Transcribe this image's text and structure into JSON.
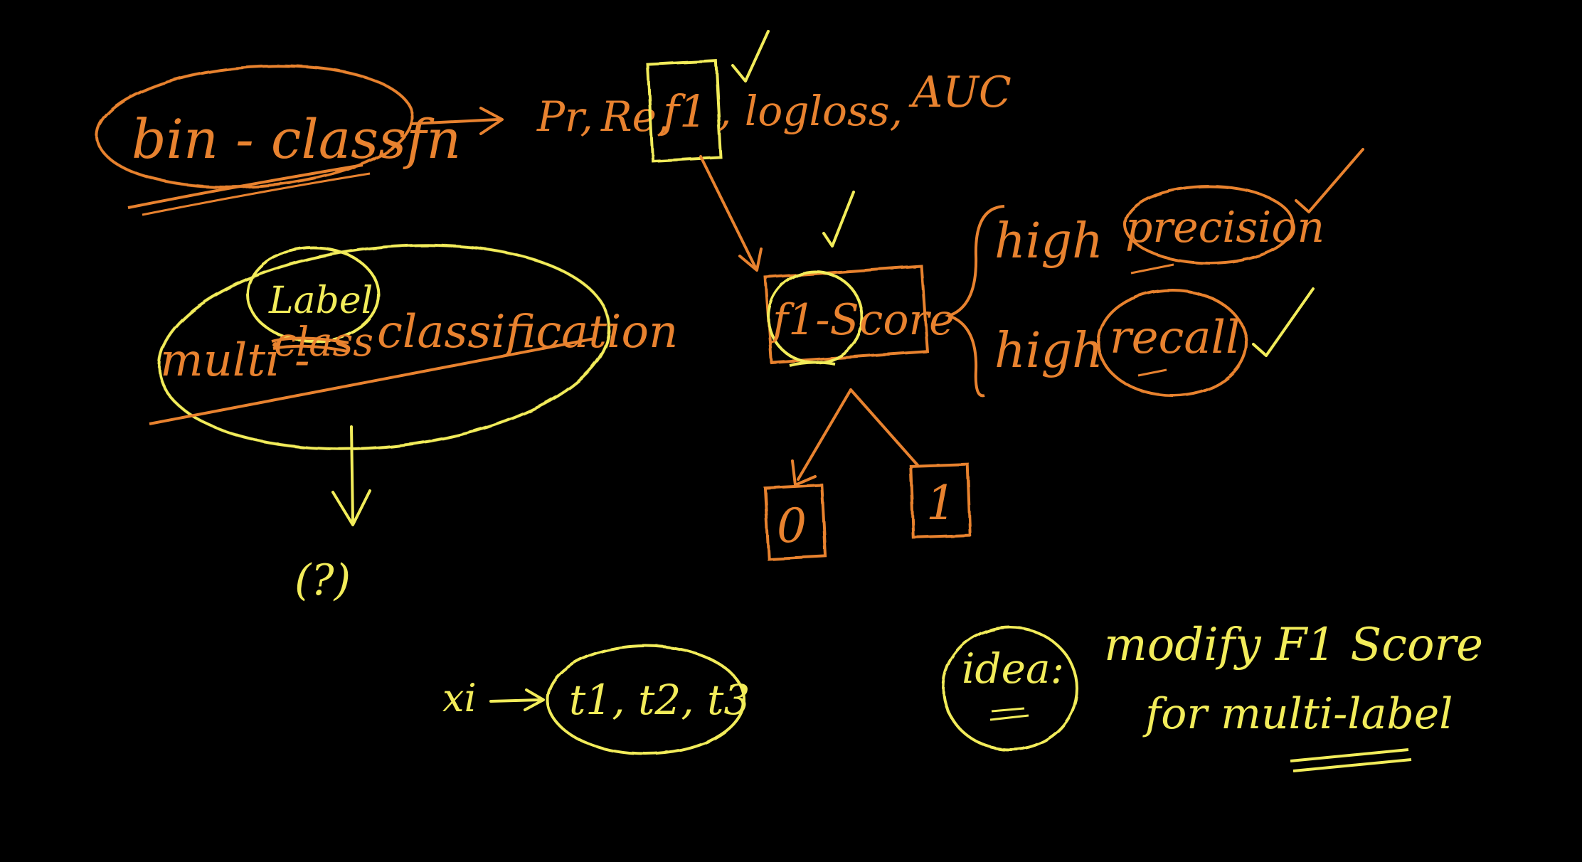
{
  "colors": {
    "background": "#000000",
    "orange": "#E8822F",
    "yellow": "#F2EC5A"
  },
  "notes": {
    "bin_classfn": "bin - classfn",
    "metrics": {
      "pr": "Pr,",
      "re": "Re,",
      "f1": "f1",
      "logloss": ", logloss,",
      "auc": "AUC"
    },
    "multi": "multi -",
    "label": "Label",
    "class_struck": "class",
    "classification": "classification",
    "question": "(?)",
    "f1_score": "f1-Score",
    "high_1": "high",
    "precision": "precision",
    "high_2": "high",
    "recall": "recall",
    "branch_0": "0",
    "branch_1": "1",
    "xi": "xi",
    "tags": "t1, t2, t3",
    "idea": "idea:",
    "modify": "modify F1 Score",
    "for_multi_label": "for multi-label"
  }
}
